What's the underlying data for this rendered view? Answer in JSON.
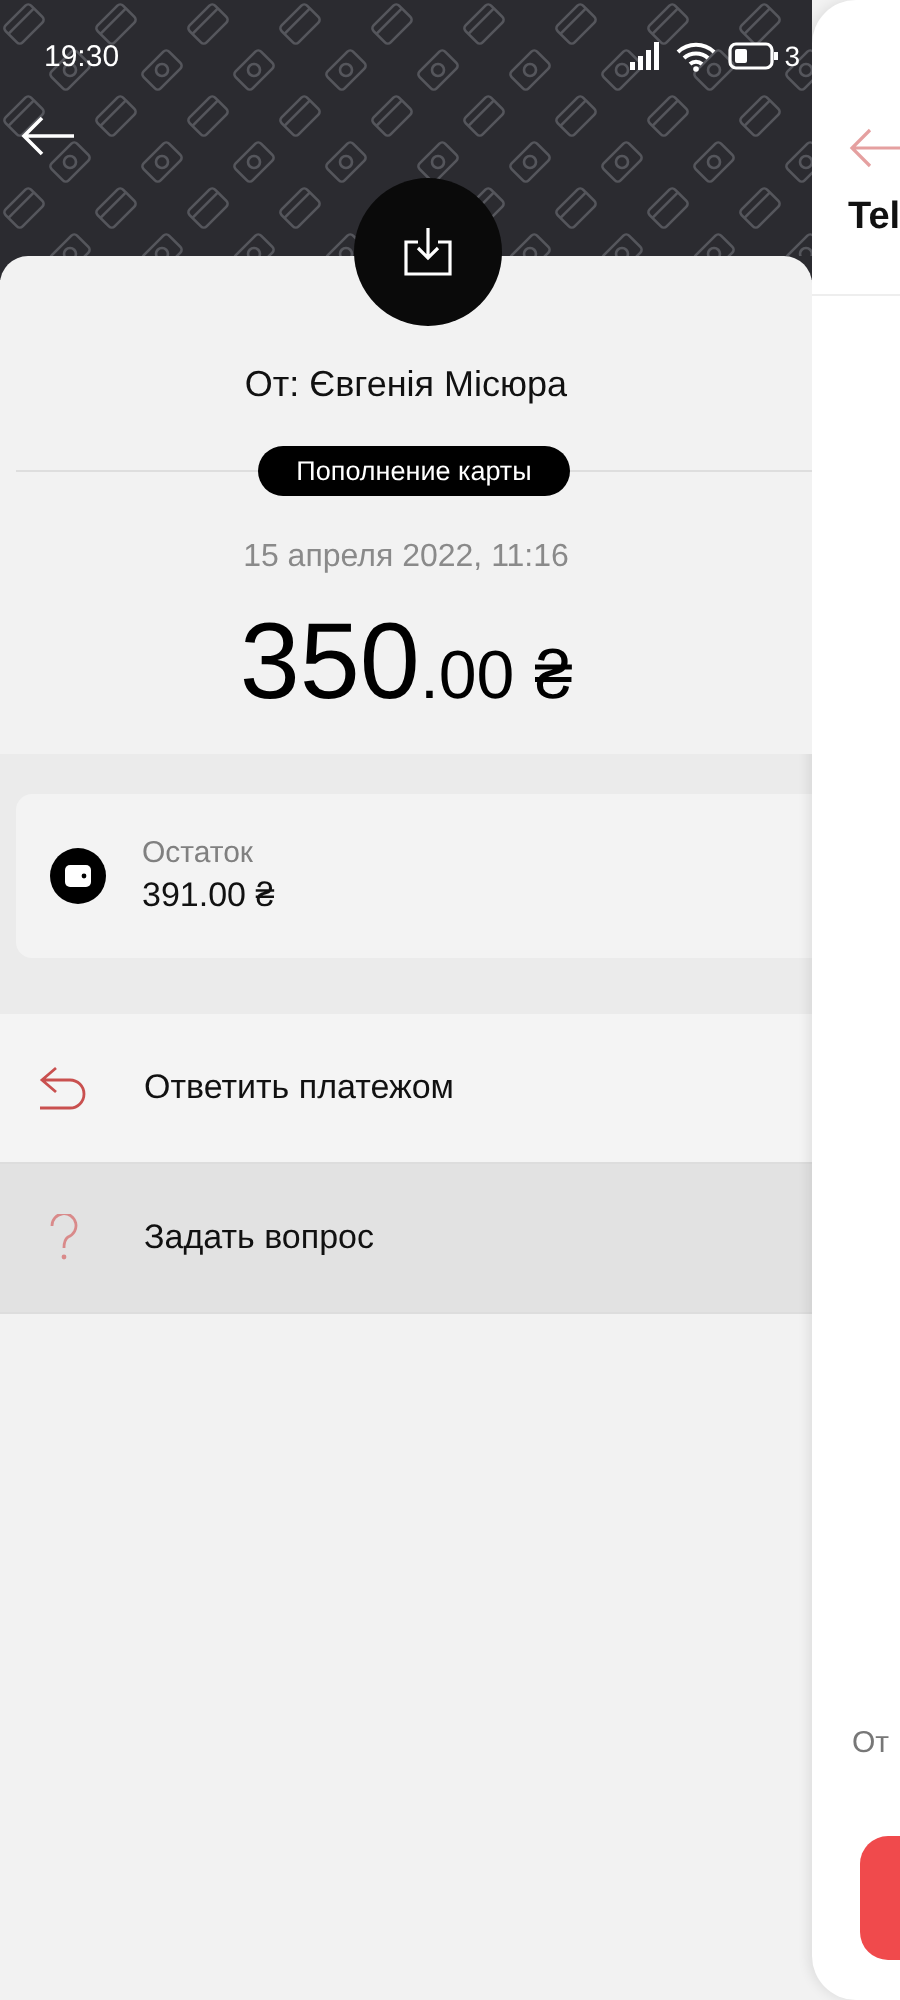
{
  "status_bar": {
    "time": "19:30",
    "battery_text": "3"
  },
  "transaction": {
    "sender": "От: Євгенія Місюра",
    "category": "Пополнение карты",
    "date": "15 апреля 2022, 11:16",
    "amount_whole": "350",
    "amount_fraction": ".00",
    "currency": "₴"
  },
  "balance": {
    "label": "Остаток",
    "value": "391.00 ₴"
  },
  "actions": [
    {
      "kind": "reply",
      "label": "Ответить платежом",
      "selected": false
    },
    {
      "kind": "question",
      "label": "Задать вопрос",
      "selected": true
    }
  ],
  "side_panel": {
    "title": "Tel",
    "label": "От"
  }
}
